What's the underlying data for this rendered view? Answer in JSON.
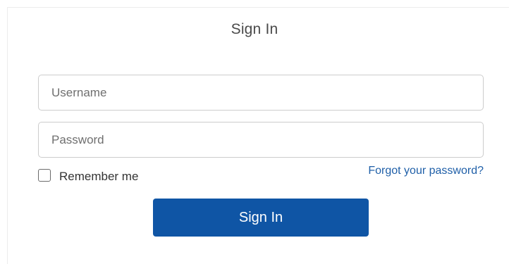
{
  "title": "Sign In",
  "username": {
    "placeholder": "Username",
    "value": ""
  },
  "password": {
    "placeholder": "Password",
    "value": ""
  },
  "remember": {
    "label": "Remember me",
    "checked": false
  },
  "forgot_link": "Forgot your password?",
  "submit_label": "Sign In",
  "colors": {
    "primary_button": "#0f55a5",
    "link": "#1f5fa8",
    "title_text": "#4a4a4a"
  }
}
